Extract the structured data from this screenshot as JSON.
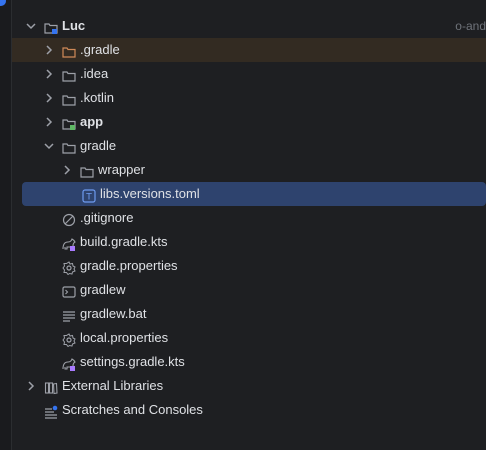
{
  "project_tree": {
    "root": {
      "label": "Luc",
      "path_hint": "o-and"
    },
    "items": [
      {
        "label": ".gradle"
      },
      {
        "label": ".idea"
      },
      {
        "label": ".kotlin"
      },
      {
        "label": "app"
      },
      {
        "label": "gradle"
      },
      {
        "label": "wrapper"
      },
      {
        "label": "libs.versions.toml",
        "icon_text": "T"
      },
      {
        "label": ".gitignore"
      },
      {
        "label": "build.gradle.kts"
      },
      {
        "label": "gradle.properties"
      },
      {
        "label": "gradlew"
      },
      {
        "label": "gradlew.bat"
      },
      {
        "label": "local.properties"
      },
      {
        "label": "settings.gradle.kts"
      },
      {
        "label": "External Libraries"
      },
      {
        "label": "Scratches and Consoles"
      }
    ]
  },
  "colors": {
    "background": "#1e1f22",
    "selected_row": "#2e436e",
    "gradle_row": "#332b22",
    "accent": "#3574f0"
  }
}
